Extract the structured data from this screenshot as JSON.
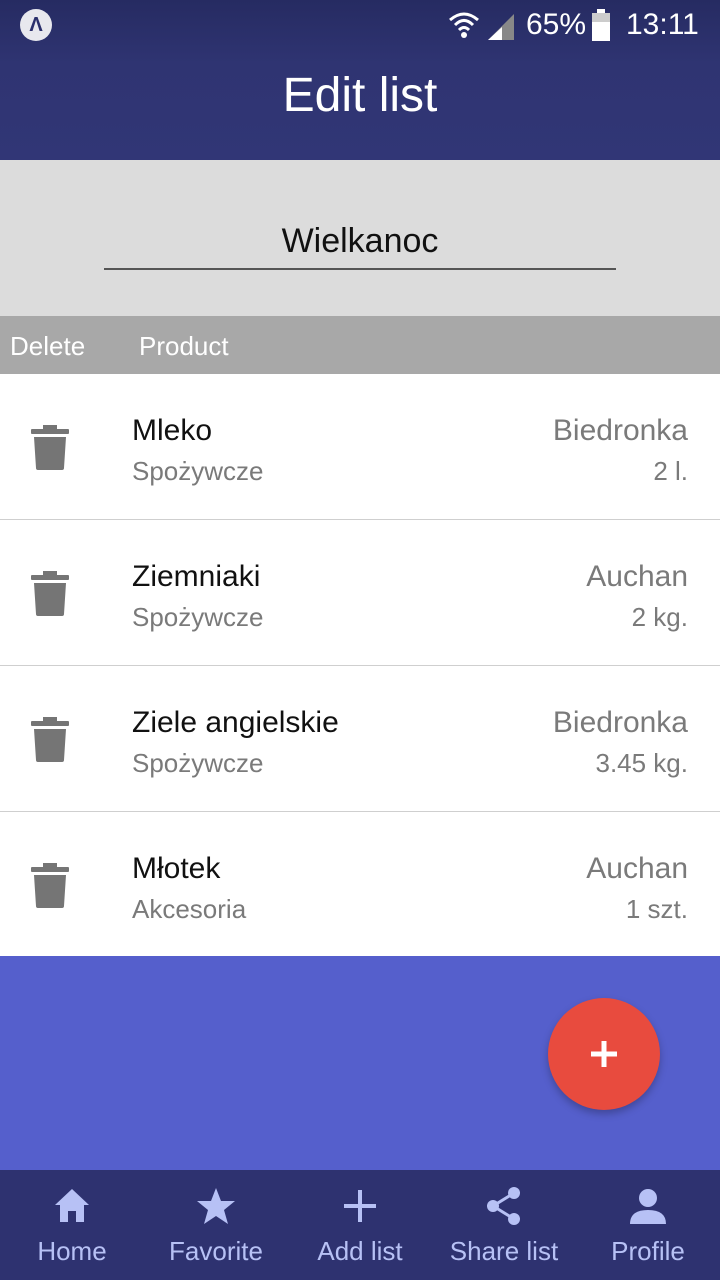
{
  "status_bar": {
    "app_badge": "Λ",
    "battery_percent": "65%",
    "time": "13:11"
  },
  "header": {
    "title": "Edit list"
  },
  "list_name": {
    "value": "Wielkanoc"
  },
  "columns": {
    "delete": "Delete",
    "product": "Product"
  },
  "items": [
    {
      "name": "Mleko",
      "category": "Spożywcze",
      "shop": "Biedronka",
      "quantity": "2 l."
    },
    {
      "name": "Ziemniaki",
      "category": "Spożywcze",
      "shop": "Auchan",
      "quantity": "2 kg."
    },
    {
      "name": "Ziele angielskie",
      "category": "Spożywcze",
      "shop": "Biedronka",
      "quantity": "3.45 kg."
    },
    {
      "name": "Młotek",
      "category": "Akcesoria",
      "shop": "Auchan",
      "quantity": "1 szt."
    }
  ],
  "fab": {
    "icon": "plus-icon"
  },
  "nav": [
    {
      "label": "Home",
      "icon": "home-icon"
    },
    {
      "label": "Favorite",
      "icon": "star-icon"
    },
    {
      "label": "Add list",
      "icon": "plus-icon"
    },
    {
      "label": "Share list",
      "icon": "share-icon"
    },
    {
      "label": "Profile",
      "icon": "person-icon"
    }
  ],
  "colors": {
    "header": "#313676",
    "body_background": "#555fcc",
    "nav_background": "#2e3270",
    "fab": "#e84b3e",
    "nav_text": "#b7c1f5"
  }
}
